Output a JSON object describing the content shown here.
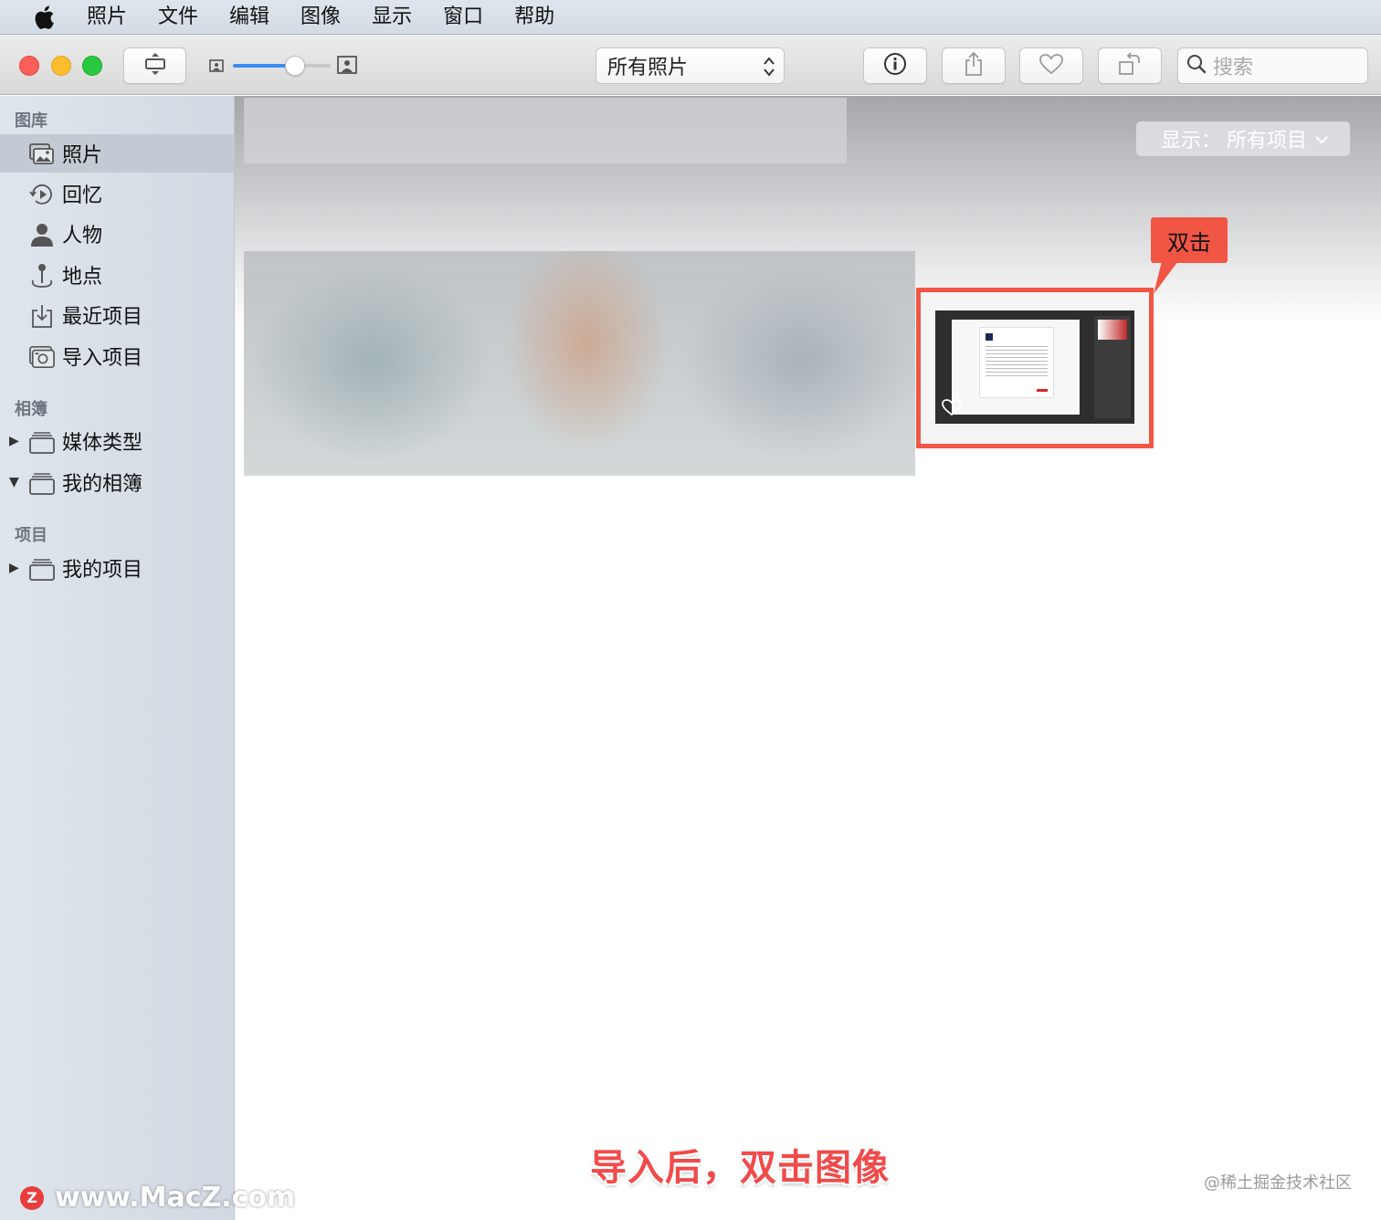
{
  "menubar": {
    "items": [
      "照片",
      "文件",
      "编辑",
      "图像",
      "显示",
      "窗口",
      "帮助"
    ]
  },
  "toolbar": {
    "album_popup_value": "所有照片",
    "search_placeholder": "搜索",
    "zoom_level": 0.6,
    "icons": [
      "window-resize-icon",
      "small-photo-icon",
      "large-photo-icon",
      "info-icon",
      "share-icon",
      "heart-icon",
      "rotate-icon",
      "search-icon"
    ]
  },
  "sidebar": {
    "library_header": "图库",
    "library_items": [
      {
        "label": "照片",
        "icon": "photos-icon",
        "selected": true
      },
      {
        "label": "回忆",
        "icon": "memories-icon"
      },
      {
        "label": "人物",
        "icon": "person-icon"
      },
      {
        "label": "地点",
        "icon": "pin-icon"
      },
      {
        "label": "最近项目",
        "icon": "import-tray-icon"
      },
      {
        "label": "导入项目",
        "icon": "camera-icon"
      }
    ],
    "albums_header": "相簿",
    "album_items": [
      {
        "label": "媒体类型",
        "icon": "album-stack-icon",
        "expanded": false
      },
      {
        "label": "我的相簿",
        "icon": "album-stack-icon",
        "expanded": true
      }
    ],
    "projects_header": "项目",
    "project_items": [
      {
        "label": "我的项目",
        "icon": "album-stack-icon",
        "expanded": false
      }
    ]
  },
  "main": {
    "show_prefix": "显示：",
    "show_value": "所有项目"
  },
  "annotation": {
    "callout_text": "双击",
    "callout_color": "#f15645"
  },
  "overlay": {
    "subtitle": "导入后，双击图像",
    "watermark_left": "www.MacZ.com",
    "watermark_left_badge": "Z",
    "watermark_right": "@稀土掘金技术社区"
  }
}
